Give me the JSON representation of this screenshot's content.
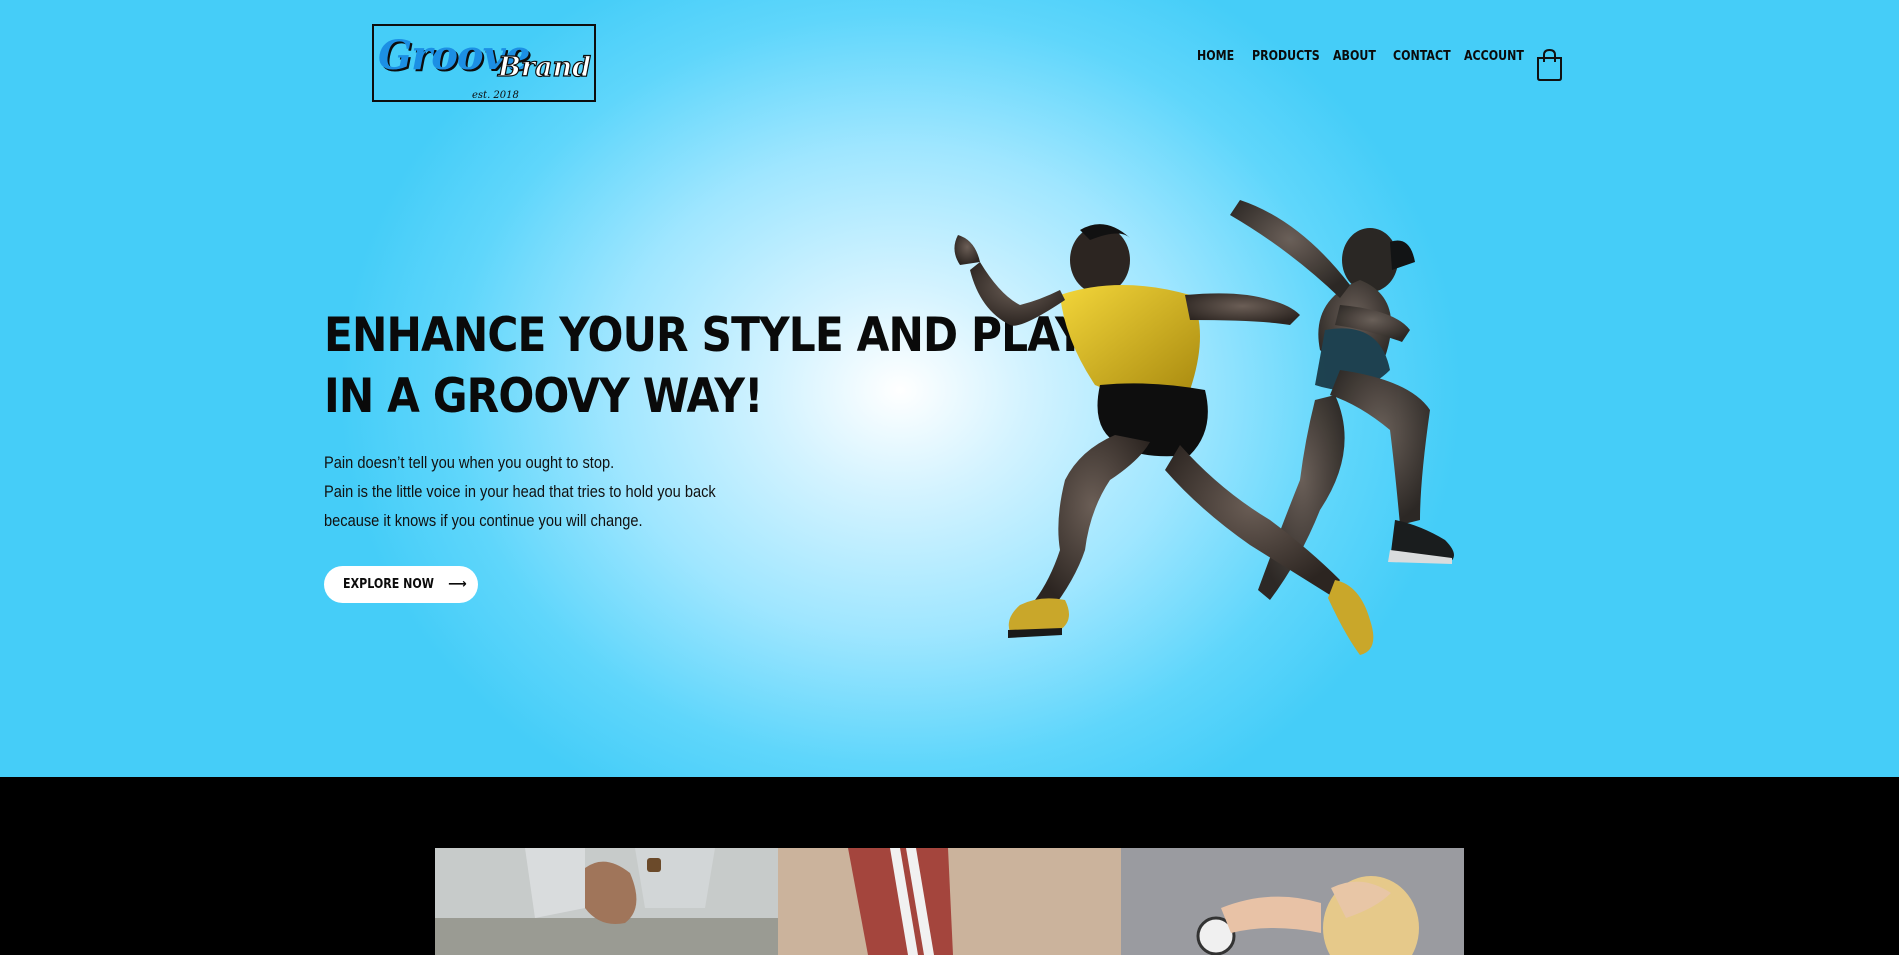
{
  "brand": {
    "name_script": "Groove",
    "name_bold": "Brand",
    "established": "est. 2018"
  },
  "nav": {
    "items": [
      "HOME",
      "PRODUCTS",
      "ABOUT",
      "CONTACT",
      "ACCOUNT"
    ]
  },
  "hero": {
    "title_line1": "ENHANCE YOUR STYLE AND PLAY",
    "title_line2": "IN A GROOVY WAY!",
    "copy_line1": "Pain doesn’t tell you when you ought to stop.",
    "copy_line2": "Pain is the little voice in your head that tries to hold you back",
    "copy_line3": "because it knows if you continue you will change.",
    "cta_label": "EXPLORE NOW",
    "cta_arrow": "⟶"
  },
  "colors": {
    "hero_bg": "#45cdf8",
    "logo_accent": "#1c8fe4",
    "text": "#0a0a0a",
    "band": "#000000"
  },
  "icons": {
    "cart": "shopping-bag-icon",
    "arrow": "arrow-right-icon"
  }
}
